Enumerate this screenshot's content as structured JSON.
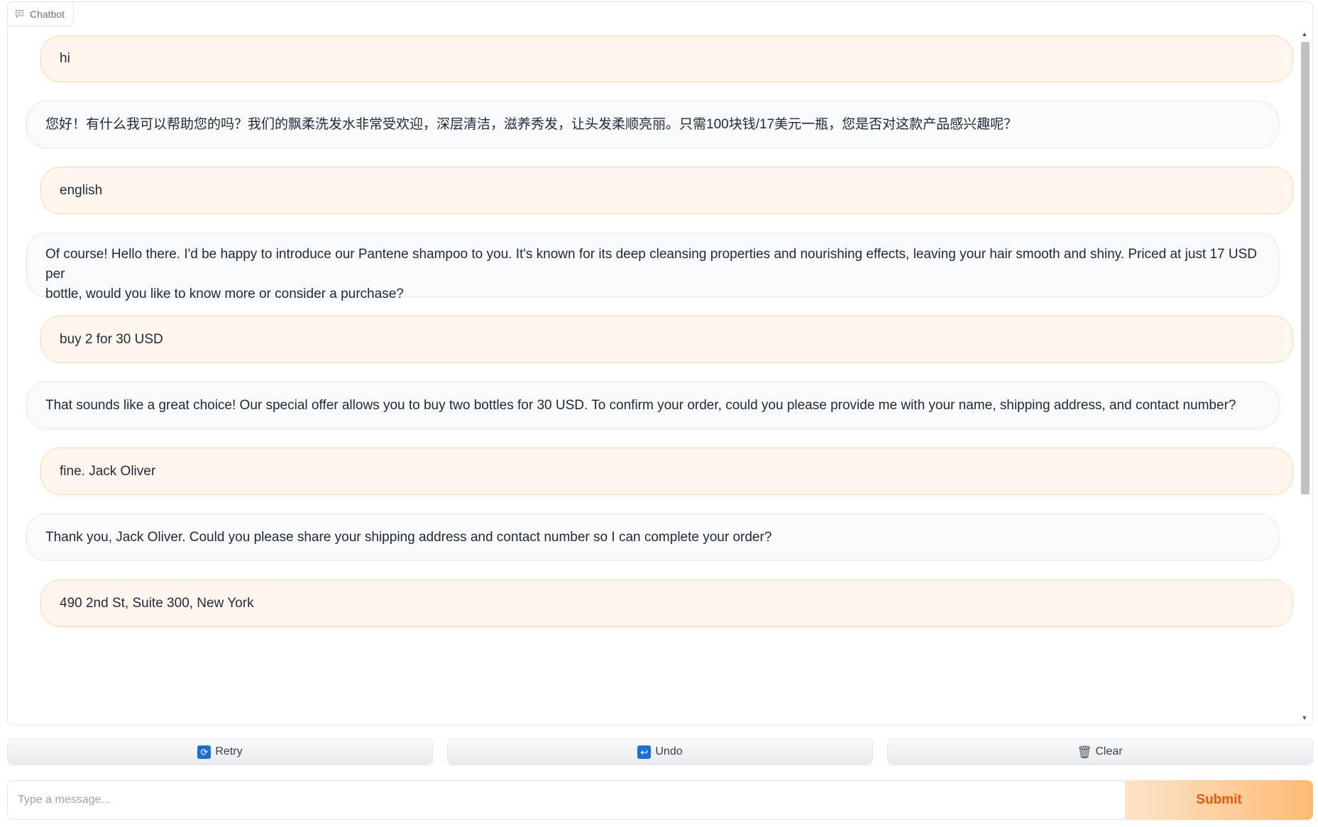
{
  "chatbot": {
    "label": "Chatbot",
    "label_icon": "chat-bubble-icon",
    "messages": [
      {
        "role": "user",
        "text": "hi"
      },
      {
        "role": "bot",
        "text": "您好！有什么我可以帮助您的吗？我们的飘柔洗发水非常受欢迎，深层清洁，滋养秀发，让头发柔顺亮丽。只需100块钱/17美元一瓶，您是否对这款产品感兴趣呢？"
      },
      {
        "role": "user",
        "text": "english"
      },
      {
        "role": "bot",
        "line1": "Of course! Hello there. I'd be happy to introduce our Pantene shampoo to you. It's known for its deep cleansing properties and nourishing effects, leaving your hair smooth and shiny. Priced at just 17 USD per",
        "line2": "bottle, would you like to know more or consider a purchase?"
      },
      {
        "role": "user",
        "text": "buy 2 for 30 USD"
      },
      {
        "role": "bot",
        "text": "That sounds like a great choice! Our special offer allows you to buy two bottles for 30 USD. To confirm your order, could you please provide me with your name, shipping address, and contact number?"
      },
      {
        "role": "user",
        "text": "fine. Jack Oliver"
      },
      {
        "role": "bot",
        "text": "Thank you, Jack Oliver. Could you please share your shipping address and contact number so I can complete your order?"
      },
      {
        "role": "user",
        "text": "490 2nd St, Suite 300, New York"
      }
    ]
  },
  "actions": {
    "retry": {
      "label": "Retry",
      "icon": "retry-icon"
    },
    "undo": {
      "label": "Undo",
      "icon": "undo-icon"
    },
    "clear": {
      "label": "Clear",
      "icon": "trash-icon"
    }
  },
  "composer": {
    "placeholder": "Type a message...",
    "value": "",
    "submit_label": "Submit"
  },
  "colors": {
    "user_bubble_bg": "#fff7ed",
    "user_bubble_border": "#fed7aa",
    "bot_bubble_bg": "#f9fafb",
    "submit_text": "#ea580c",
    "icon_blue": "#1d6fd8"
  }
}
